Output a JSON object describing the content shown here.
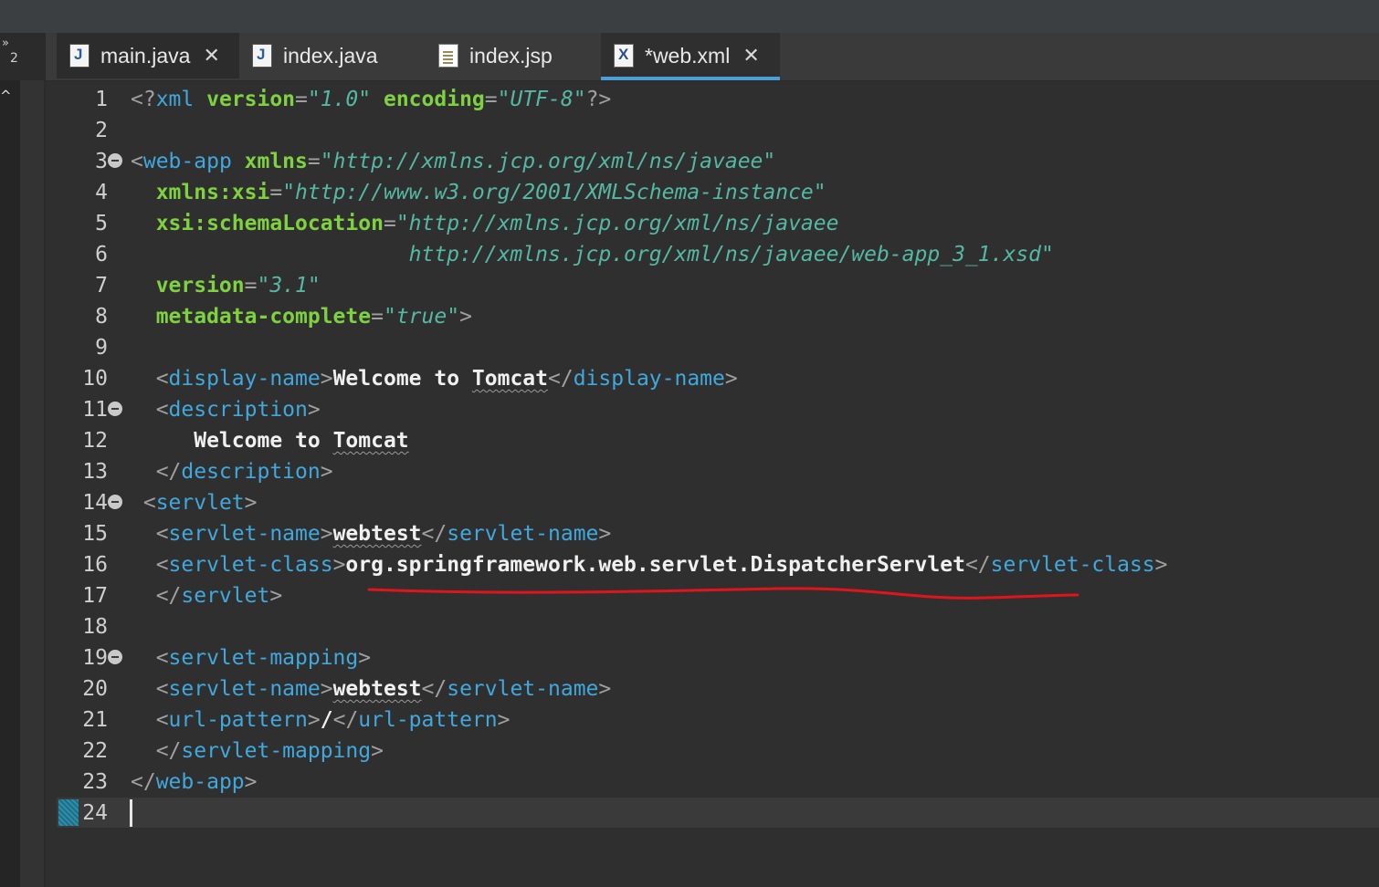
{
  "sidebar": {
    "overflow_symbol": "»",
    "overflow_count": "2",
    "collapse_symbol": "^"
  },
  "tabs": [
    {
      "label": "main.java",
      "icon": "java-file-icon",
      "close": "✕",
      "active": false
    },
    {
      "label": "index.java",
      "icon": "java-file-icon",
      "active": false
    },
    {
      "label": "index.jsp",
      "icon": "jsp-file-icon",
      "active": false
    },
    {
      "label": "*web.xml",
      "icon": "xml-file-icon",
      "close": "✕",
      "active": true
    }
  ],
  "editor": {
    "lines": [
      {
        "n": "1",
        "fold": false,
        "tokens": [
          [
            "p",
            "<?"
          ],
          [
            "t",
            "xml "
          ],
          [
            "a",
            "version"
          ],
          [
            "p",
            "="
          ],
          [
            "v",
            "\"1.0\""
          ],
          [
            "a",
            " encoding"
          ],
          [
            "p",
            "="
          ],
          [
            "v",
            "\"UTF-8\""
          ],
          [
            "p",
            "?>"
          ]
        ]
      },
      {
        "n": "2",
        "fold": false,
        "tokens": []
      },
      {
        "n": "3",
        "fold": true,
        "tokens": [
          [
            "p",
            "<"
          ],
          [
            "t",
            "web-app "
          ],
          [
            "a",
            "xmlns"
          ],
          [
            "p",
            "="
          ],
          [
            "v",
            "\"http://xmlns.jcp.org/xml/ns/javaee\""
          ]
        ]
      },
      {
        "n": "4",
        "fold": false,
        "tokens": [
          [
            "a",
            "  xmlns:xsi"
          ],
          [
            "p",
            "="
          ],
          [
            "v",
            "\"http://www.w3.org/2001/XMLSchema-instance\""
          ]
        ]
      },
      {
        "n": "5",
        "fold": false,
        "tokens": [
          [
            "a",
            "  xsi:schemaLocation"
          ],
          [
            "p",
            "="
          ],
          [
            "v",
            "\"http://xmlns.jcp.org/xml/ns/javaee"
          ]
        ]
      },
      {
        "n": "6",
        "fold": false,
        "tokens": [
          [
            "v",
            "                      http://xmlns.jcp.org/xml/ns/javaee/web-app_3_1.xsd\""
          ]
        ]
      },
      {
        "n": "7",
        "fold": false,
        "tokens": [
          [
            "a",
            "  version"
          ],
          [
            "p",
            "="
          ],
          [
            "v",
            "\"3.1\""
          ]
        ]
      },
      {
        "n": "8",
        "fold": false,
        "tokens": [
          [
            "a",
            "  metadata-complete"
          ],
          [
            "p",
            "="
          ],
          [
            "v",
            "\"true\""
          ],
          [
            "p",
            ">"
          ]
        ]
      },
      {
        "n": "9",
        "fold": false,
        "tokens": []
      },
      {
        "n": "10",
        "fold": false,
        "tokens": [
          [
            "p",
            "  <"
          ],
          [
            "t",
            "display-name"
          ],
          [
            "p",
            ">"
          ],
          [
            "x",
            "Welcome to "
          ],
          [
            "xs",
            "Tomcat"
          ],
          [
            "p",
            "</"
          ],
          [
            "t",
            "display-name"
          ],
          [
            "p",
            ">"
          ]
        ]
      },
      {
        "n": "11",
        "fold": true,
        "tokens": [
          [
            "p",
            "  <"
          ],
          [
            "t",
            "description"
          ],
          [
            "p",
            ">"
          ]
        ]
      },
      {
        "n": "12",
        "fold": false,
        "tokens": [
          [
            "x",
            "     Welcome to "
          ],
          [
            "xs",
            "Tomcat"
          ]
        ]
      },
      {
        "n": "13",
        "fold": false,
        "tokens": [
          [
            "p",
            "  </"
          ],
          [
            "t",
            "description"
          ],
          [
            "p",
            ">"
          ]
        ]
      },
      {
        "n": "14",
        "fold": true,
        "tokens": [
          [
            "p",
            " <"
          ],
          [
            "t",
            "servlet"
          ],
          [
            "p",
            ">"
          ]
        ]
      },
      {
        "n": "15",
        "fold": false,
        "tokens": [
          [
            "p",
            "  <"
          ],
          [
            "t",
            "servlet-name"
          ],
          [
            "p",
            ">"
          ],
          [
            "xs",
            "webtest"
          ],
          [
            "p",
            "</"
          ],
          [
            "t",
            "servlet-name"
          ],
          [
            "p",
            ">"
          ]
        ]
      },
      {
        "n": "16",
        "fold": false,
        "tokens": [
          [
            "p",
            "  <"
          ],
          [
            "t",
            "servlet-class"
          ],
          [
            "p",
            ">"
          ],
          [
            "x",
            "org.springframework.web.servlet.DispatcherServlet"
          ],
          [
            "p",
            "</"
          ],
          [
            "t",
            "servlet-class"
          ],
          [
            "p",
            ">"
          ]
        ]
      },
      {
        "n": "17",
        "fold": false,
        "tokens": [
          [
            "p",
            "  </"
          ],
          [
            "t",
            "servlet"
          ],
          [
            "p",
            ">"
          ]
        ]
      },
      {
        "n": "18",
        "fold": false,
        "tokens": []
      },
      {
        "n": "19",
        "fold": true,
        "tokens": [
          [
            "p",
            "  <"
          ],
          [
            "t",
            "servlet-mapping"
          ],
          [
            "p",
            ">"
          ]
        ]
      },
      {
        "n": "20",
        "fold": false,
        "tokens": [
          [
            "p",
            "  <"
          ],
          [
            "t",
            "servlet-name"
          ],
          [
            "p",
            ">"
          ],
          [
            "xs",
            "webtest"
          ],
          [
            "p",
            "</"
          ],
          [
            "t",
            "servlet-name"
          ],
          [
            "p",
            ">"
          ]
        ]
      },
      {
        "n": "21",
        "fold": false,
        "tokens": [
          [
            "p",
            "  <"
          ],
          [
            "t",
            "url-pattern"
          ],
          [
            "p",
            ">"
          ],
          [
            "x",
            "/"
          ],
          [
            "p",
            "</"
          ],
          [
            "t",
            "url-pattern"
          ],
          [
            "p",
            ">"
          ]
        ]
      },
      {
        "n": "22",
        "fold": false,
        "tokens": [
          [
            "p",
            "  </"
          ],
          [
            "t",
            "servlet-mapping"
          ],
          [
            "p",
            ">"
          ]
        ]
      },
      {
        "n": "23",
        "fold": false,
        "tokens": [
          [
            "p",
            "</"
          ],
          [
            "t",
            "web-app"
          ],
          [
            "p",
            ">"
          ]
        ]
      },
      {
        "n": "24",
        "fold": false,
        "tokens": []
      }
    ]
  },
  "colors": {
    "tag": "#40a8dc",
    "attribute": "#7ed13f",
    "value": "#55b8a4",
    "text": "#f0f0f0",
    "annotation": "#e0151b",
    "active_tab_underline": "#4a9fd6"
  }
}
